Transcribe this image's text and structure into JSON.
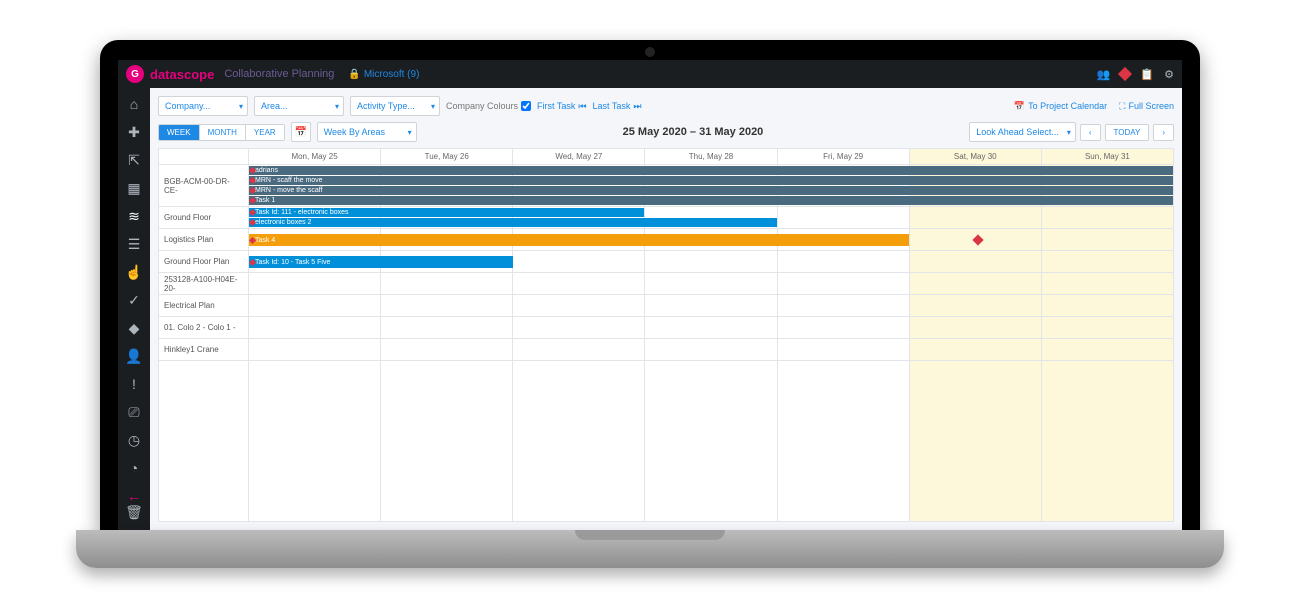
{
  "brand": "datascope",
  "sub_brand": "Collaborative Planning",
  "lock_label": "Microsoft (9)",
  "filters": {
    "company": "Company...",
    "area": "Area...",
    "activity": "Activity Type...",
    "company_colours": "Company Colours",
    "first_task": "First Task",
    "last_task": "Last Task",
    "to_calendar": "To Project Calendar",
    "full_screen": "Full Screen"
  },
  "views": {
    "week": "WEEK",
    "month": "MONTH",
    "year": "YEAR",
    "week_by_areas": "Week By Areas",
    "date_range": "25 May 2020 – 31 May 2020",
    "look_ahead": "Look Ahead Select...",
    "today": "TODAY"
  },
  "days": [
    "Mon, May 25",
    "Tue, May 26",
    "Wed, May 27",
    "Thu, May 28",
    "Fri, May 29",
    "Sat, May 30",
    "Sun, May 31"
  ],
  "rows": [
    "BGB-ACM-00-DR-CE-",
    "Ground Floor",
    "Logistics Plan",
    "Ground Floor Plan",
    "253128-A100-H04E-20-",
    "Electrical Plan",
    "01. Colo 2 - Colo 1 -",
    "Hinkley1 Crane"
  ],
  "tasks": {
    "t1": "adrians",
    "t2": "MRN - scaff the move",
    "t3": "MRN - move the scaff",
    "t4": "Task 1",
    "t5": "Task Id: 111 - electronic boxes",
    "t6": "electronic boxes 2",
    "t7": "Task 4",
    "t8": "Task Id: 10 - Task 5 Five"
  }
}
